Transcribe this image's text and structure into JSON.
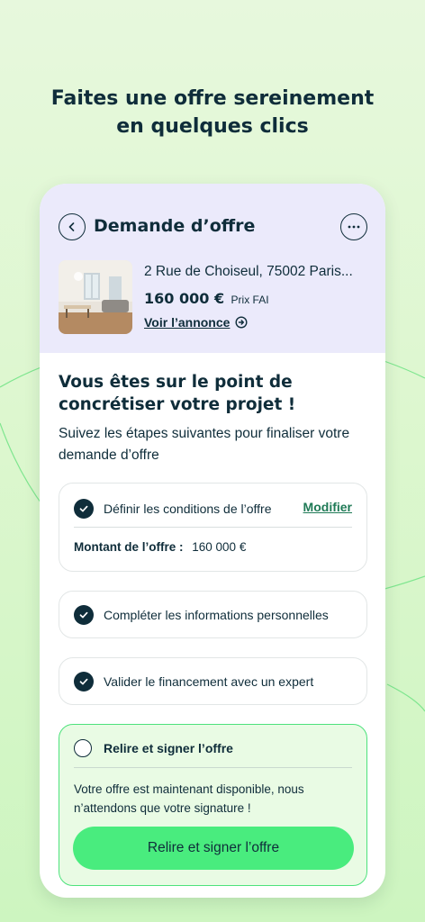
{
  "headline": {
    "line1": "Faites une offre sereinement",
    "line2": "en quelques clics"
  },
  "header": {
    "title": "Demande d’offre"
  },
  "property": {
    "address": "2 Rue de Choiseul, 75002 Paris...",
    "price": "160 000 €",
    "price_note": "Prix FAI",
    "link_label": "Voir l’annonce"
  },
  "intro": {
    "title": "Vous êtes sur le point de concrétiser votre projet !",
    "subtitle": "Suivez les étapes suivantes pour finaliser votre demande d’offre"
  },
  "steps": [
    {
      "label": "Définir les conditions de l’offre",
      "done": true,
      "action_label": "Modifier",
      "amount_label": "Montant de l’offre :",
      "amount_value": "160 000 €"
    },
    {
      "label": "Compléter les informations personnelles",
      "done": true
    },
    {
      "label": "Valider le financement avec un expert",
      "done": true
    },
    {
      "label": "Relire et signer l’offre",
      "done": false,
      "text": "Votre offre est maintenant disponible, nous n’attendons que votre signature !",
      "button_label": "Relire et signer l’offre"
    }
  ],
  "colors": {
    "brand_dark": "#0f2d3a",
    "accent_green": "#49ec7e",
    "header_bg": "#ebeafb",
    "link_green": "#1f7a56"
  },
  "icons": {
    "back": "chevron-left-icon",
    "more": "more-horizontal-icon",
    "link_arrow": "arrow-right-circle-icon",
    "step_done": "check-circle-icon"
  }
}
